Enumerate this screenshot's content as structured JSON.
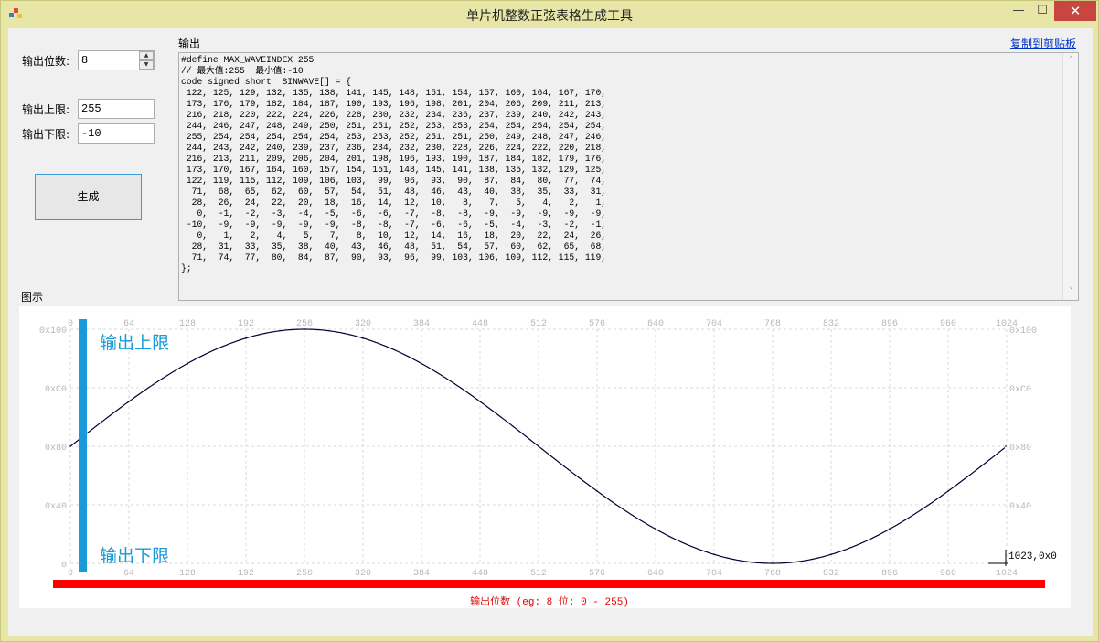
{
  "window": {
    "title": "单片机整数正弦表格生成工具",
    "minimize": "—",
    "maximize": "☐",
    "close": "✕"
  },
  "controls": {
    "bits_label": "输出位数:",
    "bits_value": "8",
    "upper_label": "输出上限:",
    "upper_value": "255",
    "lower_label": "输出下限:",
    "lower_value": "-10",
    "generate_button": "生成",
    "spin_up": "▲",
    "spin_down": "▼"
  },
  "output": {
    "label": "输出",
    "copy_link": "复制到剪贴板",
    "lines": [
      "#define MAX_WAVEINDEX 255",
      "// 最大值:255  最小值:-10",
      "code signed short  SINWAVE[] = {",
      " 122, 125, 129, 132, 135, 138, 141, 145, 148, 151, 154, 157, 160, 164, 167, 170,",
      " 173, 176, 179, 182, 184, 187, 190, 193, 196, 198, 201, 204, 206, 209, 211, 213,",
      " 216, 218, 220, 222, 224, 226, 228, 230, 232, 234, 236, 237, 239, 240, 242, 243,",
      " 244, 246, 247, 248, 249, 250, 251, 251, 252, 253, 253, 254, 254, 254, 254, 254,",
      " 255, 254, 254, 254, 254, 254, 253, 253, 252, 251, 251, 250, 249, 248, 247, 246,",
      " 244, 243, 242, 240, 239, 237, 236, 234, 232, 230, 228, 226, 224, 222, 220, 218,",
      " 216, 213, 211, 209, 206, 204, 201, 198, 196, 193, 190, 187, 184, 182, 179, 176,",
      " 173, 170, 167, 164, 160, 157, 154, 151, 148, 145, 141, 138, 135, 132, 129, 125,",
      " 122, 119, 115, 112, 109, 106, 103,  99,  96,  93,  90,  87,  84,  80,  77,  74,",
      "  71,  68,  65,  62,  60,  57,  54,  51,  48,  46,  43,  40,  38,  35,  33,  31,",
      "  28,  26,  24,  22,  20,  18,  16,  14,  12,  10,   8,   7,   5,   4,   2,   1,",
      "   0,  -1,  -2,  -3,  -4,  -5,  -6,  -6,  -7,  -8,  -8,  -9,  -9,  -9,  -9,  -9,",
      " -10,  -9,  -9,  -9,  -9,  -9,  -8,  -8,  -7,  -6,  -6,  -5,  -4,  -3,  -2,  -1,",
      "   0,   1,   2,   4,   5,   7,   8,  10,  12,  14,  16,  18,  20,  22,  24,  26,",
      "  28,  31,  33,  35,  38,  40,  43,  46,  48,  51,  54,  57,  60,  62,  65,  68,",
      "  71,  74,  77,  80,  84,  87,  90,  93,  96,  99, 103, 106, 109, 112, 115, 119,",
      "};"
    ]
  },
  "preview": {
    "label": "图示",
    "upper_limit_label": "输出上限",
    "lower_limit_label": "输出下限",
    "x_caption": "输出位数 (eg: 8 位: 0 - 255)",
    "cursor_readout": "1023,0x0"
  },
  "colors": {
    "window_frame": "#e8e6a6",
    "client": "#f0f0f0",
    "accent_blue": "#1a9ad8",
    "accent_red": "#ff0000",
    "close_button": "#c7463f",
    "grid": "#d8d8d8",
    "curve": "#000033"
  },
  "chart_data": {
    "type": "line",
    "title": "",
    "xlabel": "输出位数 (eg: 8 位: 0 - 255)",
    "ylabel": "",
    "x_ticks": [
      "0",
      "64",
      "128",
      "192",
      "256",
      "320",
      "384",
      "448",
      "512",
      "576",
      "640",
      "704",
      "768",
      "832",
      "896",
      "960",
      "1024"
    ],
    "y_ticks": [
      "0x100",
      "0xC0",
      "0x80",
      "0x40",
      "0"
    ],
    "xlim": [
      0,
      1024
    ],
    "ylim": [
      0,
      256
    ],
    "grid": true,
    "series": [
      {
        "x": [
          0,
          64,
          128,
          192,
          256,
          320,
          384,
          448,
          512,
          576,
          640,
          704,
          768,
          832,
          896,
          960,
          1023
        ],
        "values": [
          128,
          177,
          218,
          246,
          256,
          246,
          218,
          177,
          128,
          79,
          38,
          10,
          0,
          10,
          38,
          79,
          128
        ]
      }
    ]
  }
}
